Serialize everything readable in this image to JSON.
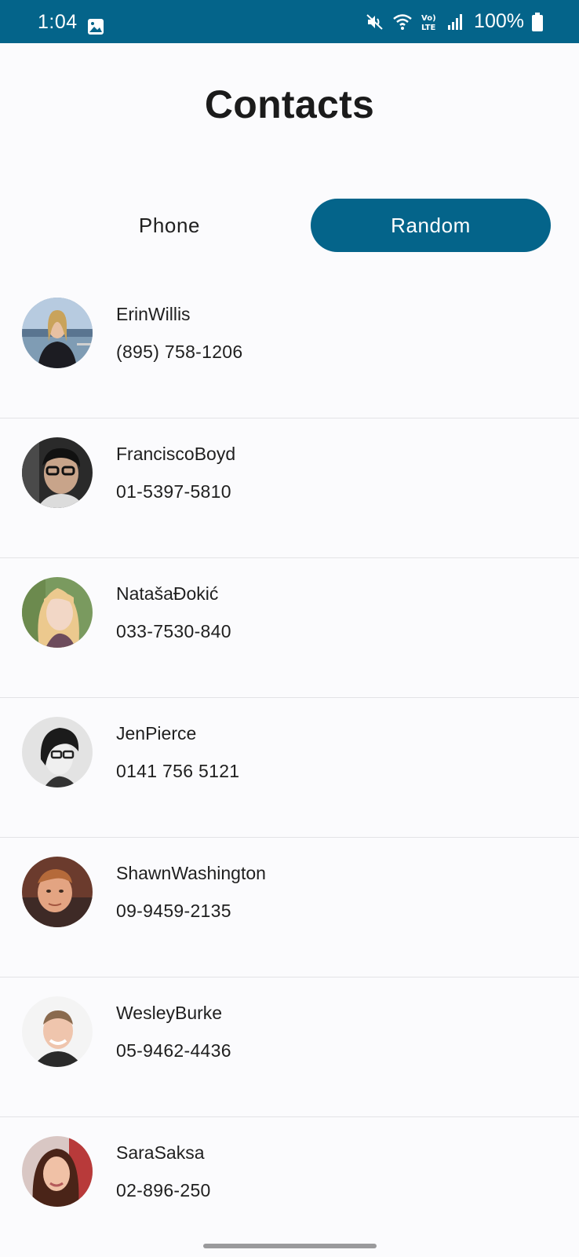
{
  "status_bar": {
    "time": "1:04",
    "battery": "100%",
    "background": "#04648a",
    "icons": [
      "image-icon",
      "mute-icon",
      "wifi-icon",
      "volte-icon",
      "signal-icon",
      "battery-icon"
    ]
  },
  "header": {
    "title": "Contacts"
  },
  "tabs": [
    {
      "label": "Phone",
      "selected": false
    },
    {
      "label": "Random",
      "selected": true
    }
  ],
  "accent_color": "#04648a",
  "contacts": [
    {
      "name": "ErinWillis",
      "phone": "(895) 758-1206"
    },
    {
      "name": "FranciscoBoyd",
      "phone": "01-5397-5810"
    },
    {
      "name": "NatašaĐokić",
      "phone": "033-7530-840"
    },
    {
      "name": "JenPierce",
      "phone": "0141 756 5121"
    },
    {
      "name": "ShawnWashington",
      "phone": "09-9459-2135"
    },
    {
      "name": "WesleyBurke",
      "phone": "05-9462-4436"
    },
    {
      "name": "SaraSaksa",
      "phone": "02-896-250"
    }
  ]
}
